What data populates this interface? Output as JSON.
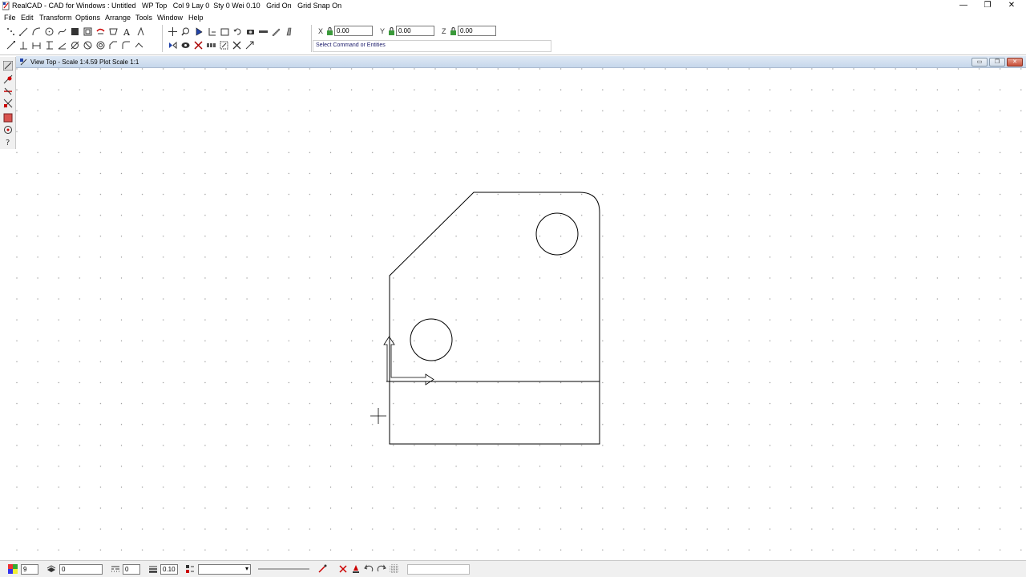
{
  "window": {
    "title": "RealCAD - CAD for Windows : Untitled   WP Top   Col 9 Lay 0  Sty 0 Wei 0.10   Grid On   Grid Snap On",
    "minimize": "—",
    "restore": "❐",
    "close": "✕"
  },
  "menu": [
    {
      "label": "File"
    },
    {
      "label": "Edit"
    },
    {
      "label": "Transform"
    },
    {
      "label": "Options"
    },
    {
      "label": "Arrange"
    },
    {
      "label": "Tools"
    },
    {
      "label": "Window"
    },
    {
      "label": "Help"
    }
  ],
  "coordinates": {
    "x_label": "X",
    "y_label": "Y",
    "z_label": "Z",
    "x_value": "0.00",
    "y_value": "0.00",
    "z_value": "0.00"
  },
  "command_prompt": "Select Command or Entities",
  "view": {
    "title": "View Top - Scale 1:4.59 Plot Scale 1:1"
  },
  "status": {
    "color_value": "9",
    "layer_value": "0",
    "style_value": "0",
    "weight_value": "0.10",
    "pen_value": ""
  },
  "colors": {
    "line": "#000000",
    "grid_dot": "#9a9a9a",
    "accent": "#1a1a6a"
  }
}
